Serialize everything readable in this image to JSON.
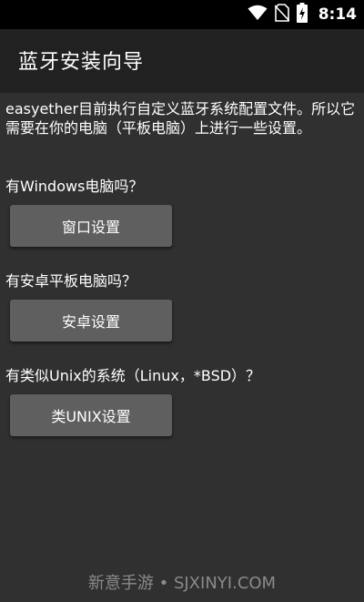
{
  "status_bar": {
    "time": "8:14",
    "icons": [
      "wifi-icon",
      "no-sim-icon",
      "battery-charging-icon"
    ]
  },
  "app_bar": {
    "title": "蓝牙安装向导"
  },
  "main": {
    "intro": "easyether目前执行自定义蓝牙系统配置文件。所以它需要在你的电脑（平板电脑）上进行一些设置。",
    "sections": [
      {
        "question": "有Windows电脑吗？",
        "button_label": "窗口设置"
      },
      {
        "question": "有安卓平板电脑吗？",
        "button_label": "安卓设置"
      },
      {
        "question": "有类似Unix的系统（Linux，*BSD）？",
        "button_label": "类UNIX设置"
      }
    ]
  },
  "watermark": "新意手游 • SJXINYI.COM",
  "colors": {
    "background": "#303030",
    "app_bar": "#212121",
    "button": "#5f5f5f",
    "text": "#ffffff"
  }
}
